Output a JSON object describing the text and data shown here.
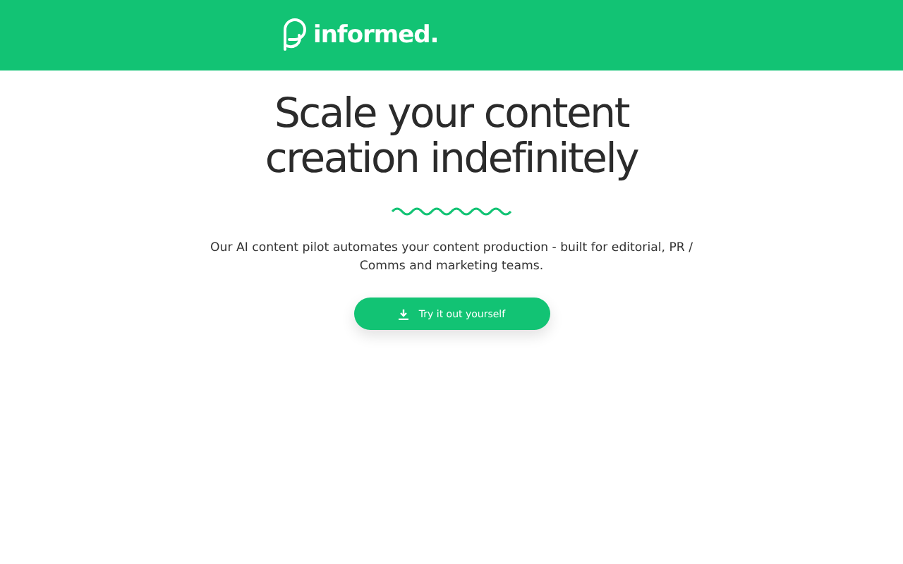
{
  "header": {
    "brand": "informed."
  },
  "hero": {
    "title_lines": [
      "Scale your content",
      "creation indefinitely"
    ],
    "description": "Our AI content pilot automates your content production - built for editorial, PR / Comms and marketing teams.",
    "button": "Try it out yourself"
  }
}
